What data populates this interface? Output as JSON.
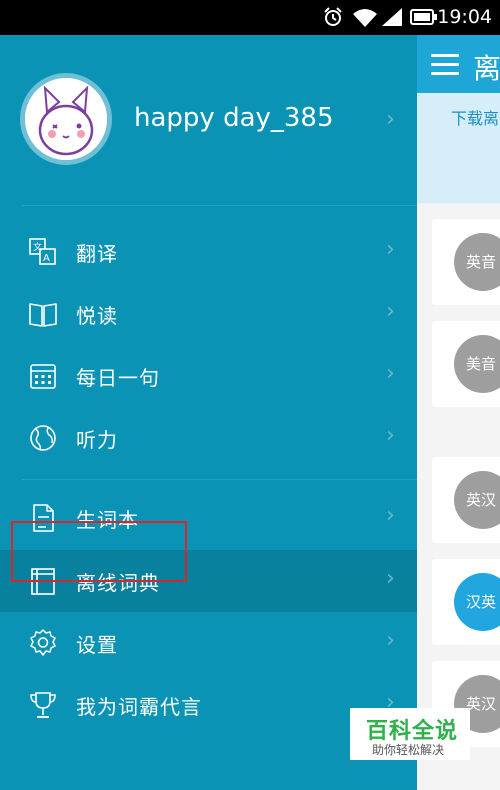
{
  "status_bar": {
    "time": "19:04"
  },
  "right_pane": {
    "header_title": "离",
    "banner_text": "下载离",
    "cards": [
      "英音",
      "美音",
      "英汉",
      "汉英",
      "英汉"
    ]
  },
  "drawer": {
    "username": "happy day_385",
    "menu_group1": [
      {
        "label": "翻译",
        "icon": "translate-icon"
      },
      {
        "label": "悦读",
        "icon": "book-open-icon"
      },
      {
        "label": "每日一句",
        "icon": "calendar-icon"
      },
      {
        "label": "听力",
        "icon": "globe-icon"
      }
    ],
    "menu_group2": [
      {
        "label": "生词本",
        "icon": "document-icon"
      },
      {
        "label": "离线词典",
        "icon": "dictionary-icon",
        "active": true
      },
      {
        "label": "设置",
        "icon": "gear-icon"
      },
      {
        "label": "我为词霸代言",
        "icon": "trophy-icon"
      }
    ]
  },
  "watermark": {
    "title": "百科全说",
    "subtitle": "助你轻松解决"
  },
  "colors": {
    "drawer_bg": "#0b93b5",
    "active_bg": "#08819f",
    "header_bg": "#1ea6d6",
    "highlight": "#d8262b"
  }
}
